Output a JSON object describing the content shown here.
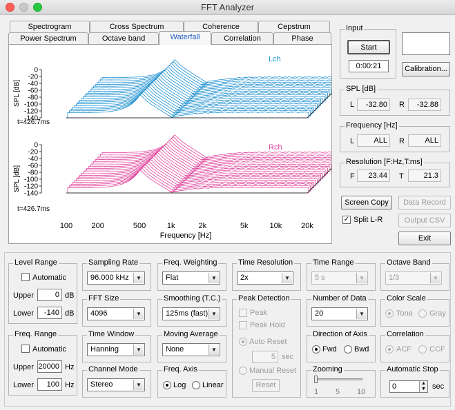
{
  "window": {
    "title": "FFT Analyzer"
  },
  "tabs": {
    "row1": [
      "Spectrogram",
      "Cross Spectrum",
      "Coherence",
      "Cepstrum"
    ],
    "row2": [
      "Power Spectrum",
      "Octave band",
      "Waterfall",
      "Correlation",
      "Phase"
    ],
    "active": "Waterfall"
  },
  "graphs": {
    "y_label": "SPL [dB]",
    "y_ticks": [
      "0",
      "-20",
      "-40",
      "-60",
      "-80",
      "-100",
      "-120",
      "-140"
    ],
    "z_ticks": [
      "0",
      "-20",
      "-40",
      "-60",
      "-80",
      "-100",
      "-120",
      "-140"
    ],
    "x_ticks": [
      "100",
      "200",
      "500",
      "1k",
      "2k",
      "5k",
      "10k",
      "20k"
    ],
    "x_label": "Frequency [Hz]",
    "time_label": "t=426.7ms",
    "top": {
      "channel": "Lch",
      "color": "#1a8fd0"
    },
    "bottom": {
      "channel": "Rch",
      "color": "#e0409a"
    }
  },
  "input": {
    "title": "Input",
    "start_label": "Start",
    "time": "0:00:21",
    "calibration_label": "Calibration..."
  },
  "spl": {
    "title": "SPL [dB]",
    "l_label": "L",
    "l_value": "-32.80",
    "r_label": "R",
    "r_value": "-32.88"
  },
  "frequency": {
    "title": "Frequency [Hz]",
    "l_label": "L",
    "l_value": "ALL",
    "r_label": "R",
    "r_value": "ALL"
  },
  "resolution": {
    "title": "Resolution [F:Hz,T:ms]",
    "f_label": "F",
    "f_value": "23.44",
    "t_label": "T",
    "t_value": "21.3"
  },
  "actions": {
    "screen_copy": "Screen Copy",
    "data_record": "Data Record",
    "split_lr": "Split L-R",
    "split_lr_checked": true,
    "output_csv": "Output CSV",
    "exit": "Exit"
  },
  "level_range": {
    "title": "Level Range",
    "automatic": "Automatic",
    "upper_label": "Upper",
    "upper_value": "0",
    "upper_unit": "dB",
    "lower_label": "Lower",
    "lower_value": "-140",
    "lower_unit": "dB"
  },
  "freq_range": {
    "title": "Freq. Range",
    "automatic": "Automatic",
    "upper_label": "Upper",
    "upper_value": "20000",
    "upper_unit": "Hz",
    "lower_label": "Lower",
    "lower_value": "100",
    "lower_unit": "Hz"
  },
  "sampling_rate": {
    "title": "Sampling Rate",
    "value": "96.000 kHz"
  },
  "fft_size": {
    "title": "FFT Size",
    "value": "4096"
  },
  "time_window": {
    "title": "Time Window",
    "value": "Hanning"
  },
  "channel_mode": {
    "title": "Channel Mode",
    "value": "Stereo"
  },
  "freq_weighting": {
    "title": "Freq. Weighting",
    "value": "Flat"
  },
  "smoothing": {
    "title": "Smoothing (T.C.)",
    "value": "125ms (fast)"
  },
  "moving_average": {
    "title": "Moving Average",
    "value": "None"
  },
  "freq_axis": {
    "title": "Freq. Axis",
    "log": "Log",
    "linear": "Linear",
    "selected": "Log"
  },
  "time_resolution": {
    "title": "Time Resolution",
    "value": "2x"
  },
  "peak_detection": {
    "title": "Peak Detection",
    "peak": "Peak",
    "peak_hold": "Peak Hold",
    "auto_reset": "Auto Reset",
    "auto_reset_value": "5",
    "auto_reset_unit": "sec",
    "manual_reset": "Manual Reset",
    "reset_button": "Reset"
  },
  "time_range": {
    "title": "Time Range",
    "value": "5 s"
  },
  "number_of_data": {
    "title": "Number of Data",
    "value": "20"
  },
  "direction_of_axis": {
    "title": "Direction of Axis",
    "fwd": "Fwd",
    "bwd": "Bwd",
    "selected": "Fwd"
  },
  "zooming": {
    "title": "Zooming",
    "ticks": [
      "1",
      "5",
      "10"
    ],
    "value": 1
  },
  "octave_band": {
    "title": "Octave Band",
    "value": "1/3"
  },
  "color_scale": {
    "title": "Color Scale",
    "tone": "Tone",
    "gray": "Gray",
    "selected": "Tone"
  },
  "correlation": {
    "title": "Correlation",
    "acf": "ACF",
    "ccf": "CCF",
    "selected": "ACF"
  },
  "automatic_stop": {
    "title": "Automatic Stop",
    "value": "0",
    "unit": "sec"
  }
}
